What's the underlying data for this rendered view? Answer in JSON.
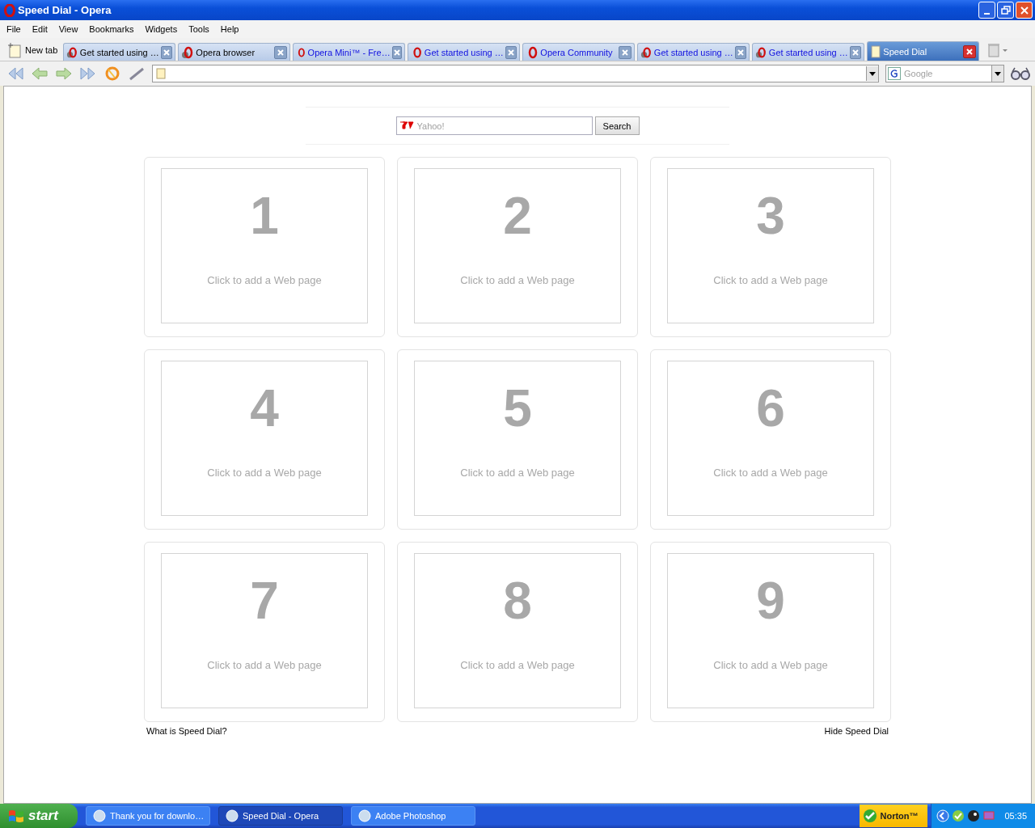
{
  "window": {
    "title": "Speed Dial - Opera"
  },
  "menu": [
    "File",
    "Edit",
    "View",
    "Bookmarks",
    "Widgets",
    "Tools",
    "Help"
  ],
  "new_tab": "New tab",
  "tabs": [
    {
      "title": "Get started using …",
      "selected": false,
      "unread": false,
      "kind": "opera-loading"
    },
    {
      "title": "Opera browser",
      "selected": false,
      "unread": false,
      "kind": "opera-loading"
    },
    {
      "title": "Opera Mini™ - Fre…",
      "selected": false,
      "unread": true,
      "kind": "opera"
    },
    {
      "title": "Get started using …",
      "selected": false,
      "unread": true,
      "kind": "opera"
    },
    {
      "title": "Opera Community",
      "selected": false,
      "unread": true,
      "kind": "opera"
    },
    {
      "title": "Get started using …",
      "selected": false,
      "unread": true,
      "kind": "opera-loading"
    },
    {
      "title": "Get started using …",
      "selected": false,
      "unread": true,
      "kind": "opera-loading"
    },
    {
      "title": "Speed Dial",
      "selected": true,
      "unread": false,
      "kind": "page"
    }
  ],
  "search_engine": {
    "placeholder": "Google"
  },
  "yahoo_search": {
    "placeholder": "Yahoo!",
    "button": "Search"
  },
  "dials": [
    {
      "number": "1",
      "label": "Click to add a Web page"
    },
    {
      "number": "2",
      "label": "Click to add a Web page"
    },
    {
      "number": "3",
      "label": "Click to add a Web page"
    },
    {
      "number": "4",
      "label": "Click to add a Web page"
    },
    {
      "number": "5",
      "label": "Click to add a Web page"
    },
    {
      "number": "6",
      "label": "Click to add a Web page"
    },
    {
      "number": "7",
      "label": "Click to add a Web page"
    },
    {
      "number": "8",
      "label": "Click to add a Web page"
    },
    {
      "number": "9",
      "label": "Click to add a Web page"
    }
  ],
  "footer": {
    "left": "What is Speed Dial?",
    "right": "Hide Speed Dial"
  },
  "taskbar": {
    "start": "start",
    "items": [
      {
        "title": "Thank you for downlo…",
        "selected": false
      },
      {
        "title": "Speed Dial - Opera",
        "selected": true
      },
      {
        "title": "Adobe Photoshop",
        "selected": false
      }
    ],
    "norton": "Norton™",
    "clock": "05:35"
  }
}
